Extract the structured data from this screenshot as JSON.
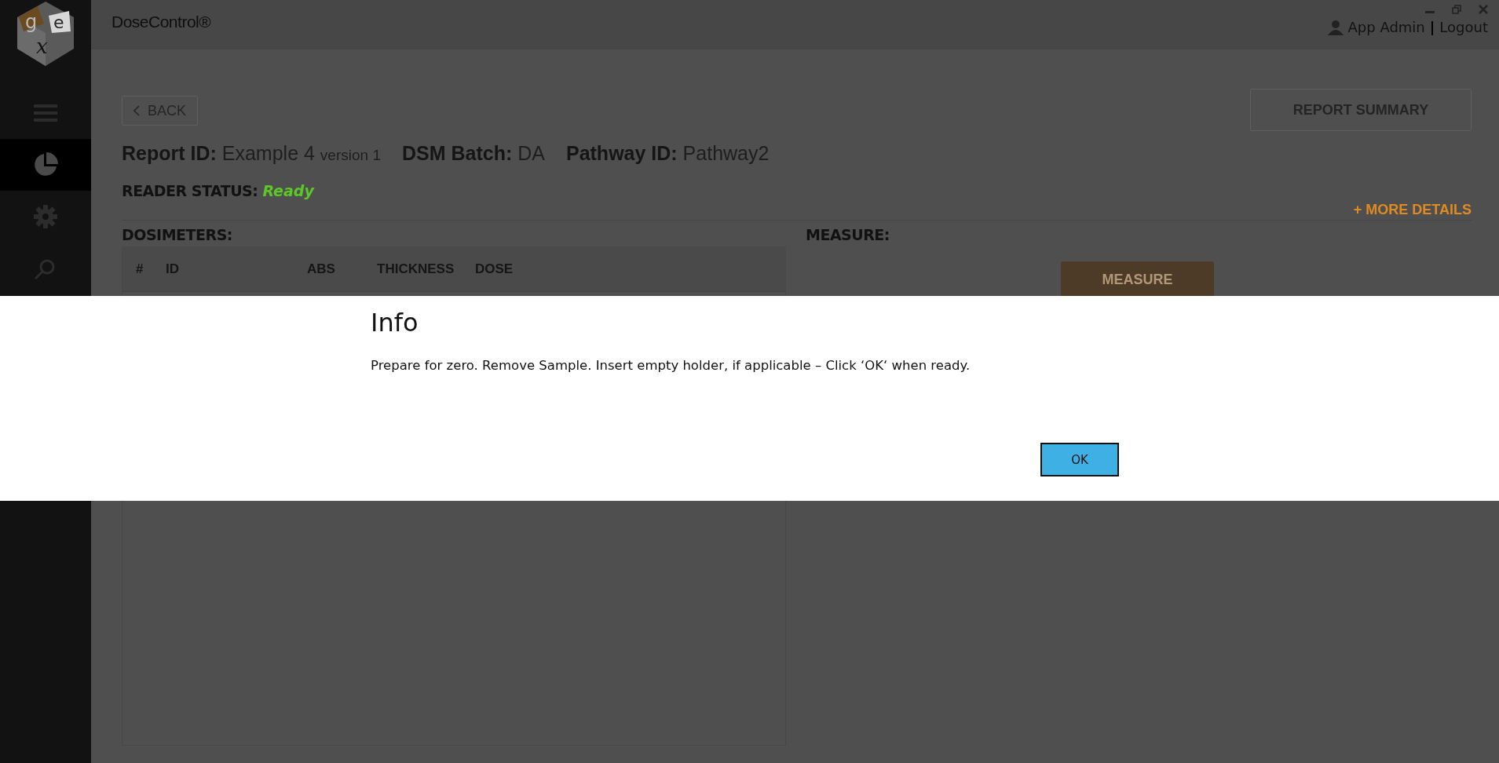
{
  "logo": {
    "letters": [
      "g",
      "e",
      "x"
    ]
  },
  "sidebar": {
    "items": [
      {
        "kind": "menu",
        "selected": false
      },
      {
        "kind": "reports",
        "selected": true
      },
      {
        "kind": "settings",
        "selected": false
      },
      {
        "kind": "search",
        "selected": false
      }
    ]
  },
  "header": {
    "title": "DoseControl®",
    "user": "App Admin",
    "separator": "|",
    "logout": "Logout"
  },
  "back_button": "BACK",
  "report_summary_button": "REPORT SUMMARY",
  "report_info": [
    {
      "label": "Report ID:",
      "value": "Example 4",
      "suffix": "version 1"
    },
    {
      "label": "DSM Batch:",
      "value": "DA"
    },
    {
      "label": "Pathway ID:",
      "value": "Pathway2"
    }
  ],
  "reader_status": {
    "label": "READER STATUS:",
    "value": "Ready"
  },
  "more_details": "+ MORE DETAILS",
  "dosimeters": {
    "title": "DOSIMETERS:",
    "columns": [
      "#",
      "ID",
      "ABS",
      "THICKNESS",
      "DOSE"
    ]
  },
  "measure": {
    "title": "MEASURE:",
    "button": "MEASURE",
    "disabled": true
  },
  "dialog": {
    "title": "Info",
    "message": "Prepare for zero. Remove Sample. Insert empty holder, if applicable – Click ‘OK‘ when ready.",
    "button": "OK"
  }
}
